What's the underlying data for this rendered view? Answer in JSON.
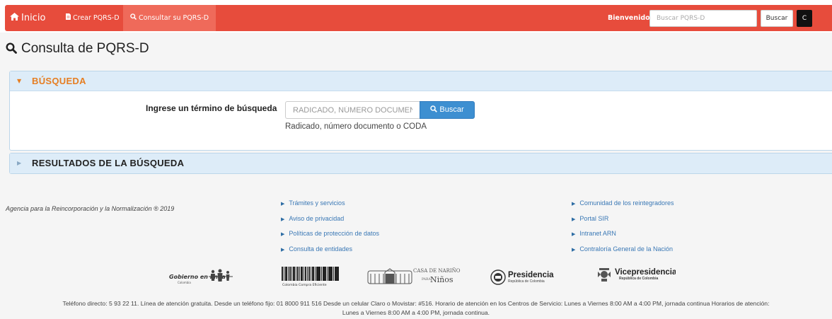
{
  "navbar": {
    "home_label": "Inicio",
    "crear_label": "Crear PQRS-D",
    "consultar_label": "Consultar su PQRS-D",
    "bienvenido": "Bienvenido",
    "search_placeholder": "Buscar PQRS-D",
    "search_button": "Buscar",
    "user_initial": "C",
    "colors": {
      "bar": "#e74c3c",
      "active": "#ef6a5a"
    }
  },
  "page": {
    "title": "Consulta de PQRS-D"
  },
  "busqueda": {
    "title": "BÚSQUEDA",
    "label": "Ingrese un término de búsqueda",
    "placeholder": "RADICADO, NÚMERO DOCUMENTO",
    "button": "Buscar",
    "help": "Radicado, número documento o CODA",
    "colors": {
      "title": "#e67e22",
      "button": "#3d8fd1"
    }
  },
  "resultados": {
    "title": "RESULTADOS DE LA BÚSQUEDA"
  },
  "footer": {
    "agency": "Agencia para la Reincorporación y la Normalización ® 2019",
    "links_col1": [
      "Trámites y servicios",
      "Aviso de privacidad",
      "Políticas de protección de datos",
      "Consulta de entidades"
    ],
    "links_col2": [
      "Comunidad de los reintegradores",
      "Portal SIR",
      "Intranet ARN",
      "Contraloría General de la Nación"
    ],
    "logos": {
      "gobierno": "Gobierno en línea",
      "gobierno_sub": "Colombia",
      "cce": "Colombia Compra Eficiente",
      "narino_top": "CASA DE NARIÑO",
      "narino_para": "PARA",
      "narino_ninos": "Niños",
      "presidencia": "Presidencia",
      "presidencia_sub": "República de Colombia",
      "vice": "Vicepresidencia",
      "vice_sub": "República de Colombia"
    },
    "contact_line1": "Teléfono directo: 5 93 22 11. Línea de atención gratuita. Desde un teléfono fijo: 01 8000 911 516 Desde un celular Claro o Movistar: #516. Horario de atención en los Centros de Servicio: Lunes a Viernes 8:00 AM a 4:00 PM, jornada continua Horarios de atención:",
    "contact_line2": "Lunes a Viernes 8:00 AM a 4:00 PM, jornada continua."
  }
}
